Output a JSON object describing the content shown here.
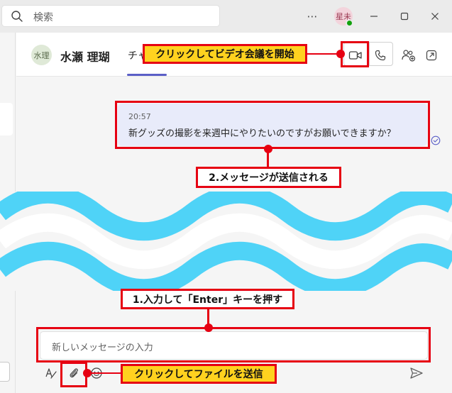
{
  "search": {
    "placeholder": "検索"
  },
  "user": {
    "avatar_initials": "星未"
  },
  "chat": {
    "contact_avatar": "水理",
    "contact_name": "水瀬 理瑚",
    "tab_label": "チャ"
  },
  "message": {
    "time": "20:57",
    "text": "新グッズの撮影を来週中にやりたいのですがお願いできますか？"
  },
  "compose": {
    "placeholder": "新しいメッセージの入力"
  },
  "annotations": {
    "video_call": "クリックしてビデオ会議を開始",
    "message_sent": "2.メッセージが送信される",
    "enter_hint": "1.入力して「Enter」キーを押す",
    "attach_file": "クリックしてファイルを送信"
  },
  "colors": {
    "accent": "#5b5fc7",
    "annotation_red": "#e60012",
    "annotation_yellow": "#ffd21f",
    "wave_blue": "#4fd3f7",
    "bubble": "#e8ebfa"
  },
  "icons": {
    "search": "search-icon",
    "more": "more-icon",
    "minimize": "minimize-icon",
    "maximize": "maximize-icon",
    "close": "close-icon",
    "video": "video-camera-icon",
    "phone": "phone-icon",
    "add_people": "add-people-icon",
    "popout": "pop-out-icon",
    "format": "format-icon",
    "attach": "paperclip-icon",
    "emoji": "emoji-icon",
    "send": "send-icon",
    "read": "read-receipt-icon"
  }
}
